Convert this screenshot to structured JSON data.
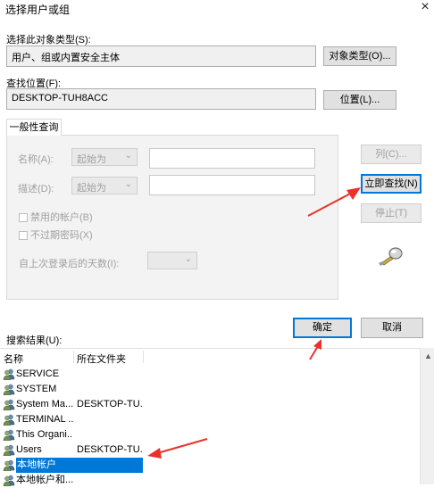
{
  "window": {
    "title": "选择用户或组",
    "close": "×"
  },
  "object_type": {
    "label": "选择此对象类型(S):",
    "value": "用户、组或内置安全主体",
    "button": "对象类型(O)..."
  },
  "location": {
    "label": "查找位置(F):",
    "value": "DESKTOP-TUH8ACC",
    "button": "位置(L)..."
  },
  "tab": {
    "label": "一般性查询"
  },
  "query": {
    "name_label": "名称(A):",
    "name_mode": "起始为",
    "desc_label": "描述(D):",
    "desc_mode": "起始为",
    "disabled_accounts": "禁用的帐户(B)",
    "no_expire": "不过期密码(X)",
    "days_label": "自上次登录后的天数(I):"
  },
  "side_buttons": {
    "columns": "列(C)...",
    "find_now": "立即查找(N)",
    "stop": "停止(T)"
  },
  "dialog_buttons": {
    "ok": "确定",
    "cancel": "取消"
  },
  "results": {
    "label": "搜索结果(U):",
    "columns": [
      "名称",
      "所在文件夹"
    ],
    "rows": [
      {
        "name": "SERVICE",
        "folder": ""
      },
      {
        "name": "SYSTEM",
        "folder": ""
      },
      {
        "name": "System Ma...",
        "folder": "DESKTOP-TU..."
      },
      {
        "name": "TERMINAL ...",
        "folder": ""
      },
      {
        "name": "This Organi...",
        "folder": ""
      },
      {
        "name": "Users",
        "folder": "DESKTOP-TU..."
      },
      {
        "name": "本地帐户",
        "folder": "",
        "selected": true
      },
      {
        "name": "本地帐户和...",
        "folder": ""
      }
    ]
  },
  "colors": {
    "accent": "#0078d7",
    "arrow": "#e8322c"
  },
  "icons": {
    "find_icon": "magnifier-search-icon",
    "user_icon": "user-group-icon"
  }
}
